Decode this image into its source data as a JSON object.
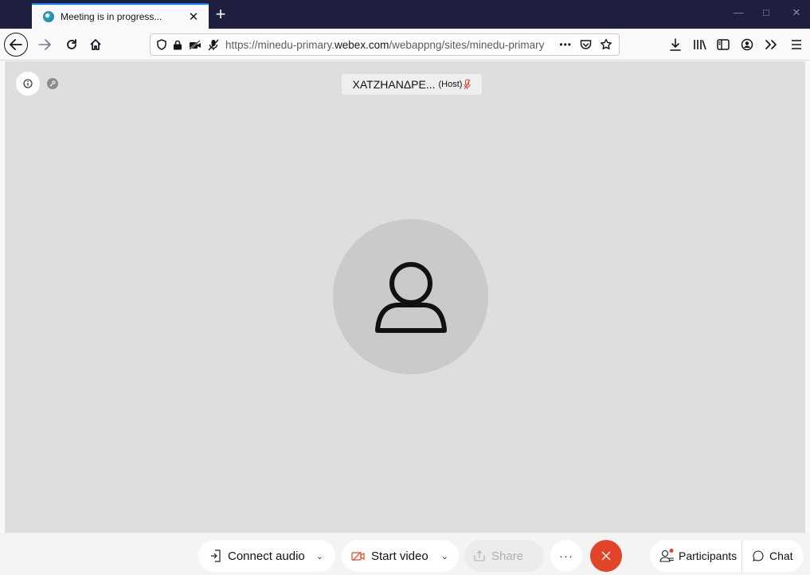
{
  "browser": {
    "tab_title": "Meeting is in progress...",
    "tab_close": "✕",
    "new_tab": "+",
    "window_controls": {
      "minimize": "—",
      "maximize": "□",
      "close": "✕"
    },
    "url_prefix": "https://minedu-primary.",
    "url_domain": "webex.com",
    "url_suffix": "/webappng/sites/minedu-primary",
    "page_actions": "•••",
    "accent_color": "#0a84ff",
    "tab_strip_color": "#1e1e3f"
  },
  "nav_icons": [
    "back-arrow-icon",
    "forward-arrow-icon",
    "reload-icon",
    "home-icon",
    "shield-icon",
    "lock-icon",
    "camera-blocked-icon",
    "microphone-blocked-icon",
    "pocket-icon",
    "bookmark-star-icon",
    "download-icon",
    "library-icon",
    "sidebar-icon",
    "account-icon",
    "overflow-icon",
    "menu-icon"
  ],
  "meeting": {
    "host_name": "XATZHANΔPE...",
    "host_tag": "(Host)",
    "background_color": "#dedede",
    "avatar_color": "#cacaca"
  },
  "toolbar": {
    "connect_audio": "Connect audio",
    "start_video": "Start video",
    "share": "Share",
    "more": "···",
    "participants": "Participants",
    "chat": "Chat",
    "leave_color": "#e24429",
    "video_icon_color": "#e24429",
    "participants_badge_color": "#e24429"
  }
}
